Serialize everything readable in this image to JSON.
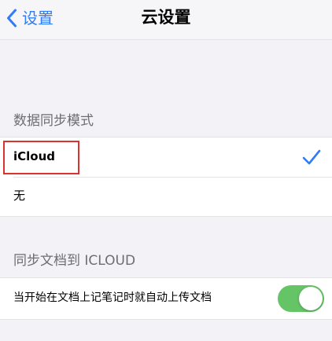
{
  "nav": {
    "back_label": "设置",
    "title": "云设置"
  },
  "sync_mode": {
    "header": "数据同步模式",
    "options": [
      {
        "label": "iCloud",
        "selected": true
      },
      {
        "label": "无",
        "selected": false
      }
    ]
  },
  "doc_sync": {
    "header": "同步文档到 ICLOUD",
    "auto_upload_label": "当开始在文档上记笔记时就自动上传文档",
    "auto_upload_enabled": true
  },
  "colors": {
    "accent": "#2f7cf6",
    "toggle_on": "#65c466",
    "highlight": "#d9342b",
    "background": "#f2f2f7"
  },
  "icons": {
    "back": "chevron-left-icon",
    "selected": "checkmark-icon"
  }
}
